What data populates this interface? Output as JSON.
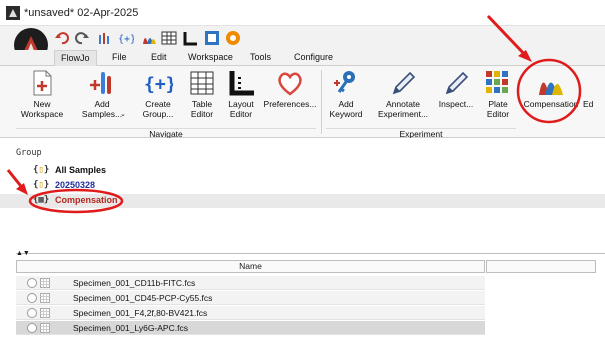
{
  "window": {
    "title": "*unsaved* 02-Apr-2025"
  },
  "menubar": {
    "items": [
      "FlowJo",
      "File",
      "Edit",
      "Workspace",
      "Tools",
      "Configure"
    ],
    "active": "FlowJo"
  },
  "ribbon": {
    "buttons": {
      "new_workspace": "New\nWorkspace",
      "add_samples": "Add\nSamples...",
      "create_group": "Create\nGroup...",
      "table_editor": "Table\nEditor",
      "layout_editor": "Layout\nEditor",
      "preferences": "Preferences...",
      "add_keyword": "Add\nKeyword",
      "annotate_experiment": "Annotate\nExperiment...",
      "inspect": "Inspect...",
      "plate_editor": "Plate\nEditor",
      "compensation": "Compensation",
      "partial": "Ed"
    },
    "groups": {
      "navigate": "Navigate",
      "experiment": "Experiment"
    }
  },
  "tree": {
    "header": "Group",
    "items": [
      {
        "label": "All Samples",
        "color": "#111111"
      },
      {
        "label": "20250328",
        "color": "#1f2f9a"
      },
      {
        "label": "Compensation",
        "color": "#b3261e"
      }
    ]
  },
  "table": {
    "column_name": "Name",
    "rows": [
      "Specimen_001_CD11b-FITC.fcs",
      "Specimen_001_CD45-PCP-Cy55.fcs",
      "Specimen_001_F4,2f,80-BV421.fcs",
      "Specimen_001_Ly6G-APC.fcs"
    ]
  },
  "colors": {
    "annotation_red": "#e01b1b",
    "compensation_text": "#b3261e",
    "date_group_text": "#1f2f9a"
  }
}
